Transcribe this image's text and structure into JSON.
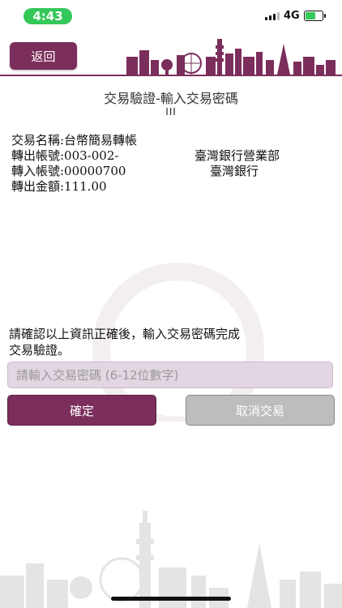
{
  "status_bar": {
    "time": "4:43",
    "network": "4G",
    "time_pill_color": "#34c759",
    "battery_icon": "charging-battery-icon"
  },
  "header": {
    "back_label": "返回",
    "brand_color": "#7b2e5c",
    "decoration": "city-skyline-icon"
  },
  "page": {
    "title": "交易驗證-輸入交易密碼",
    "page_num": "III"
  },
  "transaction": {
    "name_row": "交易名稱:台幣簡易轉帳",
    "from_row": "轉出帳號:003-002-",
    "from_bank": "臺灣銀行營業部",
    "to_row": "轉入帳號:00000700",
    "to_bank": "臺灣銀行",
    "amount_row": "轉出金額:111.00"
  },
  "confirm": {
    "line1": "請確認以上資訊正確後，輸入交易密碼完成",
    "line2": "交易驗證。"
  },
  "password_field": {
    "value": "",
    "placeholder": "請輸入交易密碼 (6-12位數字)"
  },
  "actions": {
    "ok_label": "確定",
    "cancel_label": "取消交易"
  }
}
